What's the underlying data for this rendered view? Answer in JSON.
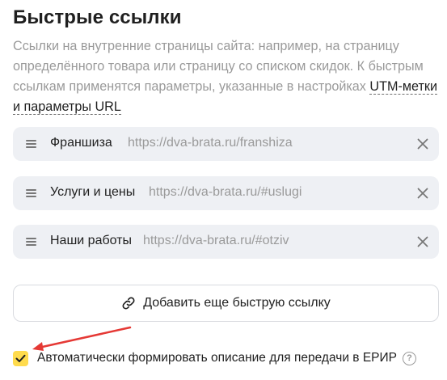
{
  "section": {
    "title": "Быстрые ссылки",
    "description": "Ссылки на внутренние страницы сайта: например, на страницу определённого товара или страницу со списком скидок. К быстрым ссылкам применятся параметры, указанные в настройках ",
    "description_link": "UTM-метки и параметры URL"
  },
  "quick_links": [
    {
      "name": "Франшиза",
      "url": "https://dva-brata.ru/franshiza"
    },
    {
      "name": "Услуги и цены",
      "url": "https://dva-brata.ru/#uslugi"
    },
    {
      "name": "Наши работы",
      "url": "https://dva-brata.ru/#otziv"
    }
  ],
  "add_button": {
    "label": "Добавить еще быструю ссылку",
    "icon": "link-icon"
  },
  "auto_description": {
    "label": "Автоматически формировать описание для передачи в ЕРИР",
    "checked": true,
    "help_icon": "question-circle-icon"
  },
  "colors": {
    "checkbox": "#ffdb4d",
    "row_background": "#eef0f4",
    "arrow": "#e53935"
  }
}
